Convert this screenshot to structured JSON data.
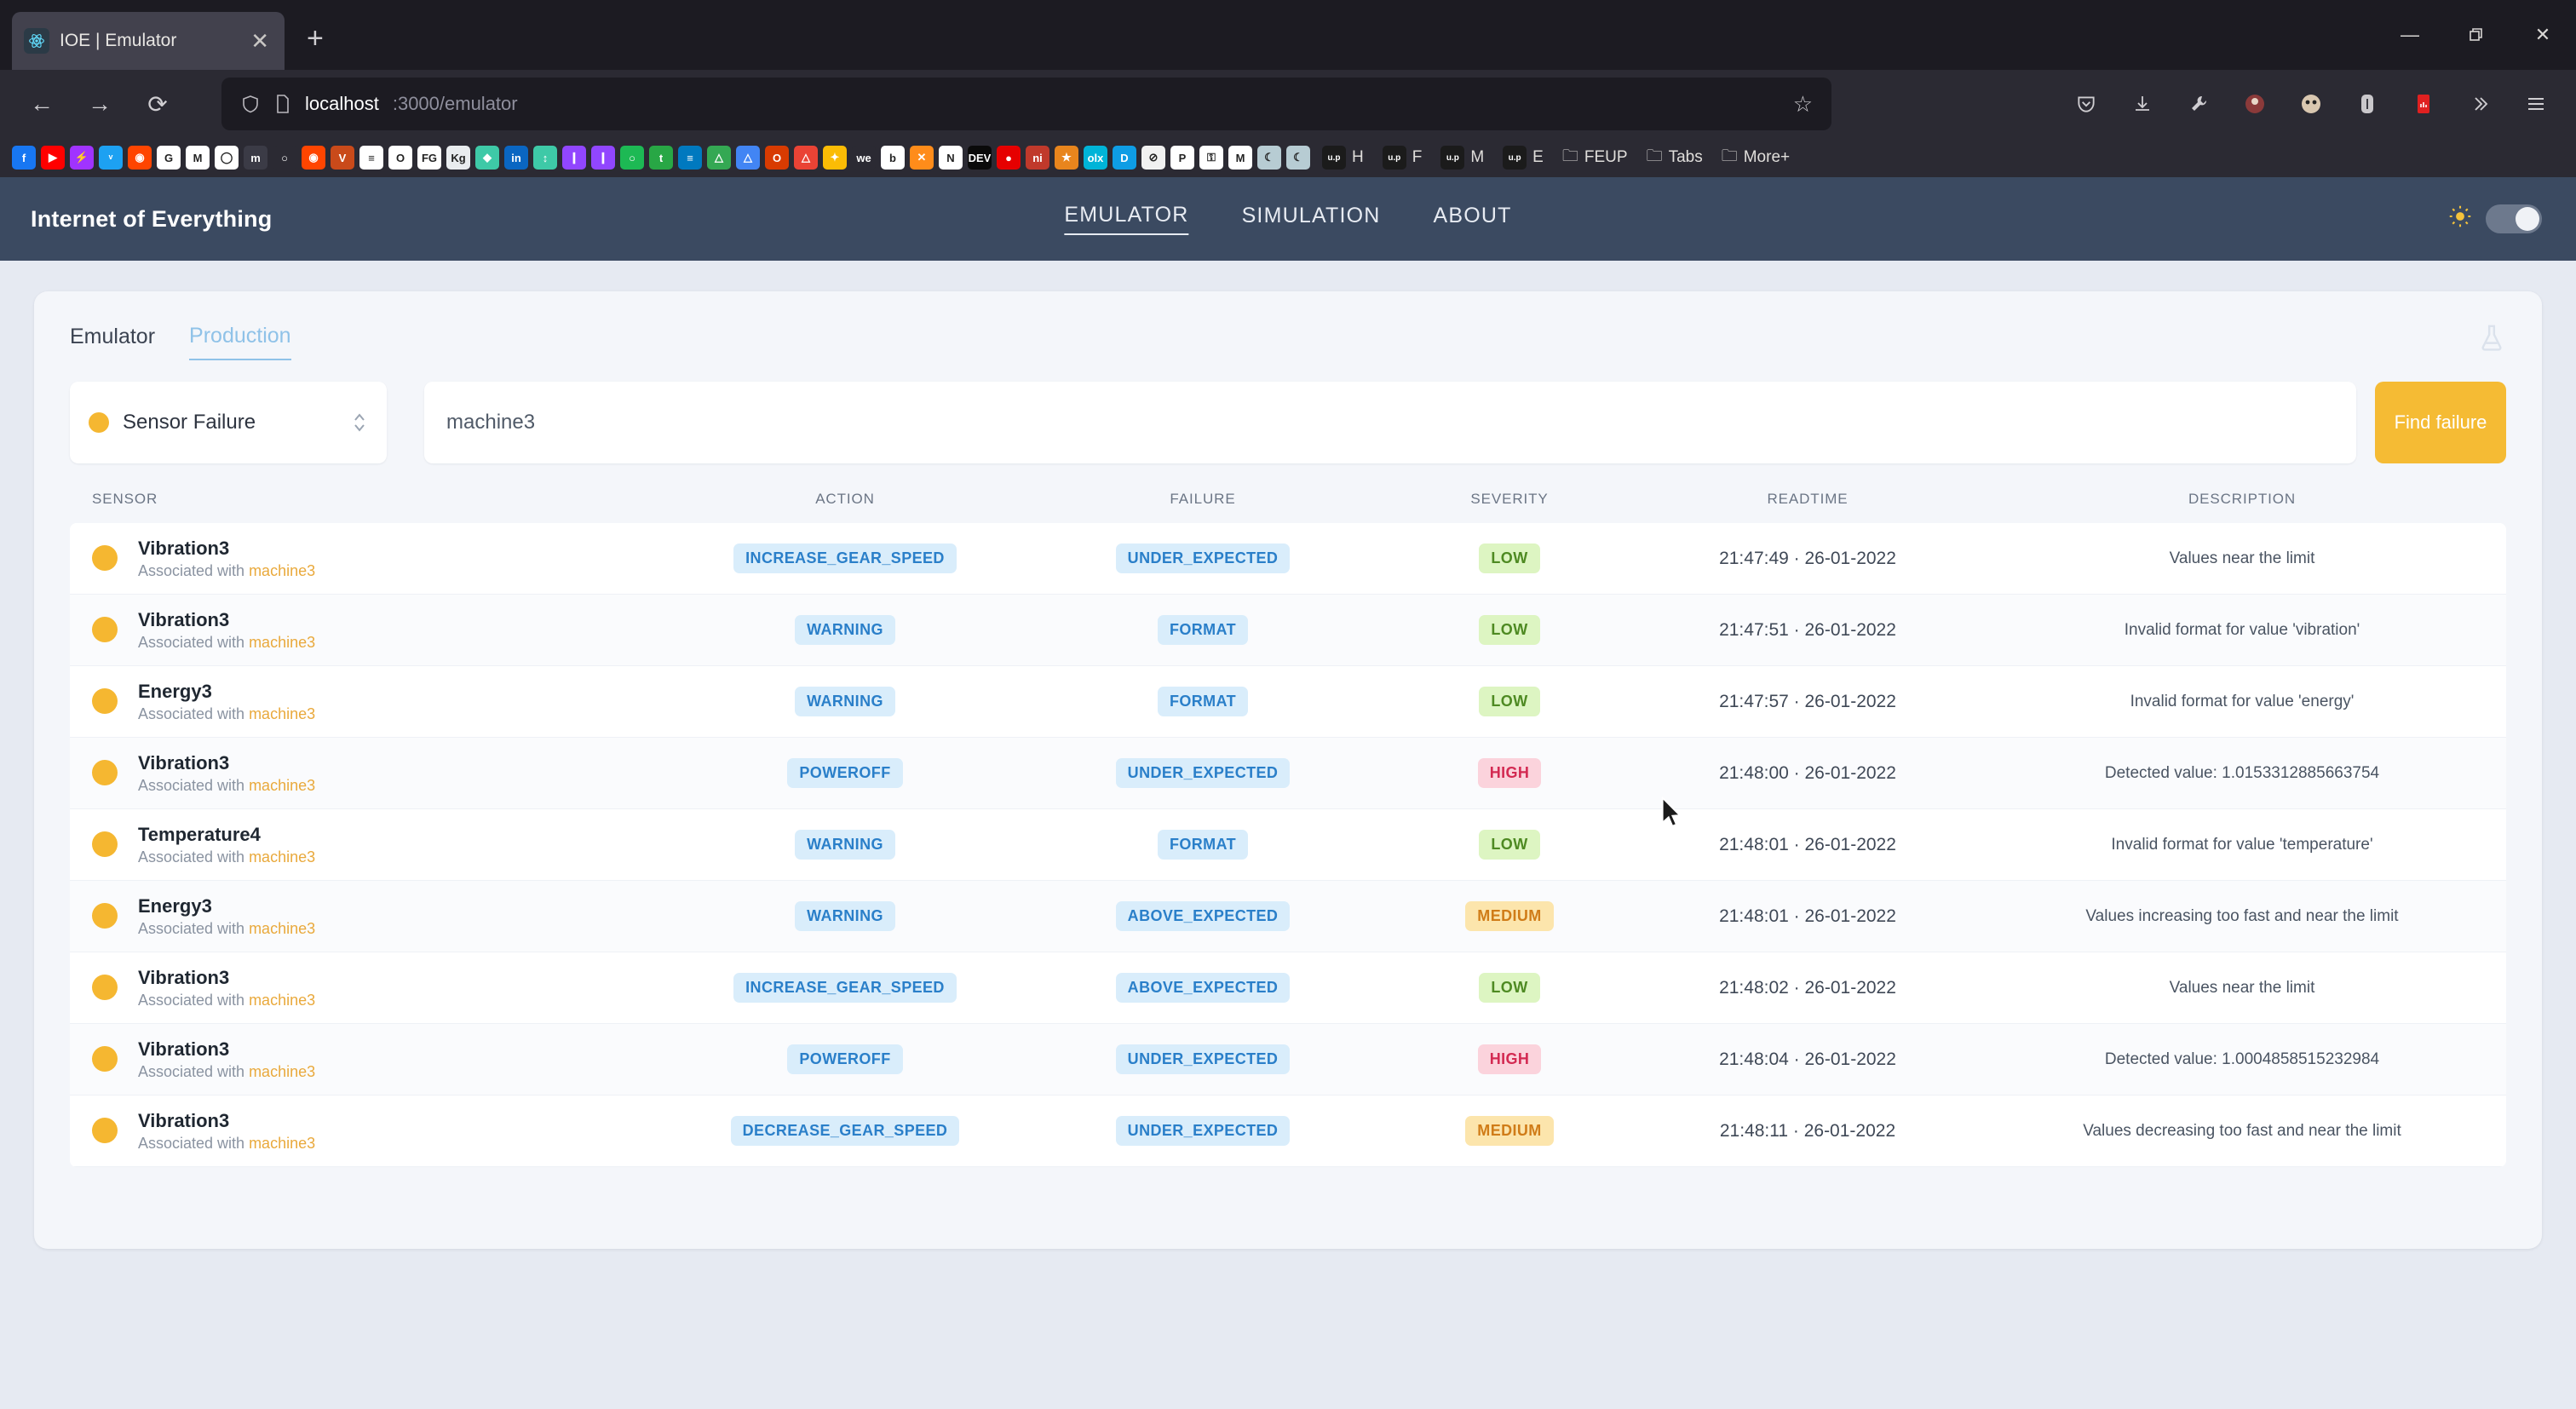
{
  "browser": {
    "tab_title": "IOE | Emulator",
    "tab_favicon": "react-atom-icon",
    "close_tab_label": "✕",
    "new_tab_label": "+",
    "back_label": "←",
    "forward_label": "→",
    "reload_label": "⟳",
    "url_host": "localhost",
    "url_path": ":3000/emulator",
    "shield_icon": "⬠",
    "page_icon": "⎘",
    "star_label": "☆",
    "window": {
      "minimize": "—",
      "maximize": "❐",
      "close": "✕"
    },
    "toolbar_icons": [
      {
        "name": "pocket-icon",
        "glyph": "⬡"
      },
      {
        "name": "downloads-icon",
        "glyph": "⬇"
      },
      {
        "name": "wrench-icon",
        "glyph": "ὒ7"
      },
      {
        "name": "extension-avatar-icon",
        "glyph": "●"
      },
      {
        "name": "account-avatar-icon",
        "glyph": "●"
      },
      {
        "name": "reader-icon",
        "glyph": "▯"
      },
      {
        "name": "pdf-extension-icon",
        "glyph": "▮"
      },
      {
        "name": "overflow-chevrons-icon",
        "glyph": "»"
      },
      {
        "name": "hamburger-menu-icon",
        "glyph": "☰"
      }
    ],
    "bookmarks": [
      {
        "name": "facebook",
        "color": "#1877f2",
        "glyph": "f"
      },
      {
        "name": "youtube",
        "color": "#ff0000",
        "glyph": "▶"
      },
      {
        "name": "messenger",
        "color": "#a033ff",
        "glyph": "⚡"
      },
      {
        "name": "twitter",
        "color": "#1da1f2",
        "glyph": "ᵛ"
      },
      {
        "name": "reddit",
        "color": "#ff4500",
        "glyph": "◉"
      },
      {
        "name": "google",
        "color": "#ffffff",
        "glyph": "G"
      },
      {
        "name": "gmail",
        "color": "#ffffff",
        "glyph": "M"
      },
      {
        "name": "whatsapp",
        "color": "#ffffff",
        "glyph": "◯"
      },
      {
        "name": "moodle",
        "color": "#3b3b46",
        "glyph": "m"
      },
      {
        "name": "github",
        "color": "#2b2a33",
        "glyph": "○"
      },
      {
        "name": "reddit-2",
        "color": "#ff4500",
        "glyph": "◉"
      },
      {
        "name": "vim",
        "color": "#c94a1a",
        "glyph": "V"
      },
      {
        "name": "docs",
        "color": "#ffffff",
        "glyph": "≡"
      },
      {
        "name": "opera",
        "color": "#ffffff",
        "glyph": "O"
      },
      {
        "name": "figma-fg",
        "color": "#ffffff",
        "glyph": "FG"
      },
      {
        "name": "kaggle",
        "color": "#e9ecef",
        "glyph": "Kg"
      },
      {
        "name": "sketch",
        "color": "#3ec9a7",
        "glyph": "◆"
      },
      {
        "name": "linkedin",
        "color": "#0a66c2",
        "glyph": "in"
      },
      {
        "name": "unsplash",
        "color": "#3ec9a7",
        "glyph": "↕"
      },
      {
        "name": "twitch",
        "color": "#9146ff",
        "glyph": "❙"
      },
      {
        "name": "twitch-2",
        "color": "#9146ff",
        "glyph": "❙"
      },
      {
        "name": "spotify",
        "color": "#1db954",
        "glyph": "○"
      },
      {
        "name": "teams",
        "color": "#28a745",
        "glyph": "t"
      },
      {
        "name": "trello",
        "color": "#0079bf",
        "glyph": "≡"
      },
      {
        "name": "drive",
        "color": "#34a853",
        "glyph": "△"
      },
      {
        "name": "drive-2",
        "color": "#4285f4",
        "glyph": "△"
      },
      {
        "name": "office",
        "color": "#d83b01",
        "glyph": "O"
      },
      {
        "name": "drive-3",
        "color": "#ea4335",
        "glyph": "△"
      },
      {
        "name": "slides",
        "color": "#fbbc05",
        "glyph": "✦"
      },
      {
        "name": "we-transfer",
        "color": "#2b2a33",
        "glyph": "we"
      },
      {
        "name": "behance",
        "color": "#ffffff",
        "glyph": "b"
      },
      {
        "name": "x-app",
        "color": "#ff8c1a",
        "glyph": "✕"
      },
      {
        "name": "notion",
        "color": "#ffffff",
        "glyph": "N"
      },
      {
        "name": "devto",
        "color": "#0a0a0a",
        "glyph": "DEV"
      },
      {
        "name": "vodafone",
        "color": "#e60000",
        "glyph": "●"
      },
      {
        "name": "ni-app",
        "color": "#c0392b",
        "glyph": "ni"
      },
      {
        "name": "orange-app",
        "color": "#e8851d",
        "glyph": "★"
      },
      {
        "name": "olx",
        "color": "#00b4d8",
        "glyph": "olx"
      },
      {
        "name": "dashlane",
        "color": "#0e9de5",
        "glyph": "D"
      },
      {
        "name": "opera-gx",
        "color": "#f1f1f1",
        "glyph": "⊘"
      },
      {
        "name": "paypal",
        "color": "#ffffff",
        "glyph": "P"
      },
      {
        "name": "bitwarden",
        "color": "#ffffff",
        "glyph": "⚿"
      },
      {
        "name": "medium",
        "color": "#ffffff",
        "glyph": "M"
      },
      {
        "name": "moon-app",
        "color": "#b7ccd3",
        "glyph": "☾"
      },
      {
        "name": "moon-app-2",
        "color": "#b7ccd3",
        "glyph": "☾"
      }
    ],
    "bookmark_labels": [
      "H",
      "F",
      "M",
      "E"
    ],
    "bookmark_folders": [
      "FEUP",
      "Tabs",
      "More+"
    ]
  },
  "app": {
    "brand": "Internet of Everything",
    "nav": [
      {
        "label": "EMULATOR",
        "active": true
      },
      {
        "label": "SIMULATION",
        "active": false
      },
      {
        "label": "ABOUT",
        "active": false
      }
    ],
    "theme": {
      "sun_icon": "sun-icon",
      "toggle_state": "off"
    }
  },
  "panel": {
    "tabs": [
      {
        "label": "Emulator",
        "active": false
      },
      {
        "label": "Production",
        "active": true
      }
    ],
    "flask_icon": "flask-icon",
    "filter": {
      "select_label": "Sensor Failure",
      "select_dot_color": "#f5b731",
      "search_value": "machine3",
      "search_placeholder": "machine3",
      "button_label": "Find failure",
      "button_color": "#f5bb34"
    },
    "table": {
      "columns": [
        "SENSOR",
        "ACTION",
        "FAILURE",
        "SEVERITY",
        "READTIME",
        "DESCRIPTION"
      ],
      "associated_prefix": "Associated with",
      "rows": [
        {
          "sensor": "Vibration3",
          "machine": "machine3",
          "action": "INCREASE_GEAR_SPEED",
          "failure": "UNDER_EXPECTED",
          "severity": "LOW",
          "readtime": "21:47:49 · 26-01-2022",
          "description": "Values near the limit"
        },
        {
          "sensor": "Vibration3",
          "machine": "machine3",
          "action": "WARNING",
          "failure": "FORMAT",
          "severity": "LOW",
          "readtime": "21:47:51 · 26-01-2022",
          "description": "Invalid format for value 'vibration'"
        },
        {
          "sensor": "Energy3",
          "machine": "machine3",
          "action": "WARNING",
          "failure": "FORMAT",
          "severity": "LOW",
          "readtime": "21:47:57 · 26-01-2022",
          "description": "Invalid format for value 'energy'"
        },
        {
          "sensor": "Vibration3",
          "machine": "machine3",
          "action": "POWEROFF",
          "failure": "UNDER_EXPECTED",
          "severity": "HIGH",
          "readtime": "21:48:00 · 26-01-2022",
          "description": "Detected value: 1.0153312885663754"
        },
        {
          "sensor": "Temperature4",
          "machine": "machine3",
          "action": "WARNING",
          "failure": "FORMAT",
          "severity": "LOW",
          "readtime": "21:48:01 · 26-01-2022",
          "description": "Invalid format for value 'temperature'"
        },
        {
          "sensor": "Energy3",
          "machine": "machine3",
          "action": "WARNING",
          "failure": "ABOVE_EXPECTED",
          "severity": "MEDIUM",
          "readtime": "21:48:01 · 26-01-2022",
          "description": "Values increasing too fast and near the limit"
        },
        {
          "sensor": "Vibration3",
          "machine": "machine3",
          "action": "INCREASE_GEAR_SPEED",
          "failure": "ABOVE_EXPECTED",
          "severity": "LOW",
          "readtime": "21:48:02 · 26-01-2022",
          "description": "Values near the limit"
        },
        {
          "sensor": "Vibration3",
          "machine": "machine3",
          "action": "POWEROFF",
          "failure": "UNDER_EXPECTED",
          "severity": "HIGH",
          "readtime": "21:48:04 · 26-01-2022",
          "description": "Detected value: 1.0004858515232984"
        },
        {
          "sensor": "Vibration3",
          "machine": "machine3",
          "action": "DECREASE_GEAR_SPEED",
          "failure": "UNDER_EXPECTED",
          "severity": "MEDIUM",
          "readtime": "21:48:11 · 26-01-2022",
          "description": "Values decreasing too fast and near the limit"
        }
      ]
    }
  },
  "colors": {
    "header_bg": "#3b4a61",
    "page_bg": "#e6eaf2",
    "accent_amber": "#f5b731",
    "badge_blue_bg": "#d9edfb",
    "badge_blue_fg": "#2a7fc9",
    "severity_low_bg": "#ddf5c2",
    "severity_low_fg": "#4e8a22",
    "severity_medium_bg": "#fce5ac",
    "severity_medium_fg": "#d07c18",
    "severity_high_bg": "#fbd3dc",
    "severity_high_fg": "#d32a52"
  }
}
